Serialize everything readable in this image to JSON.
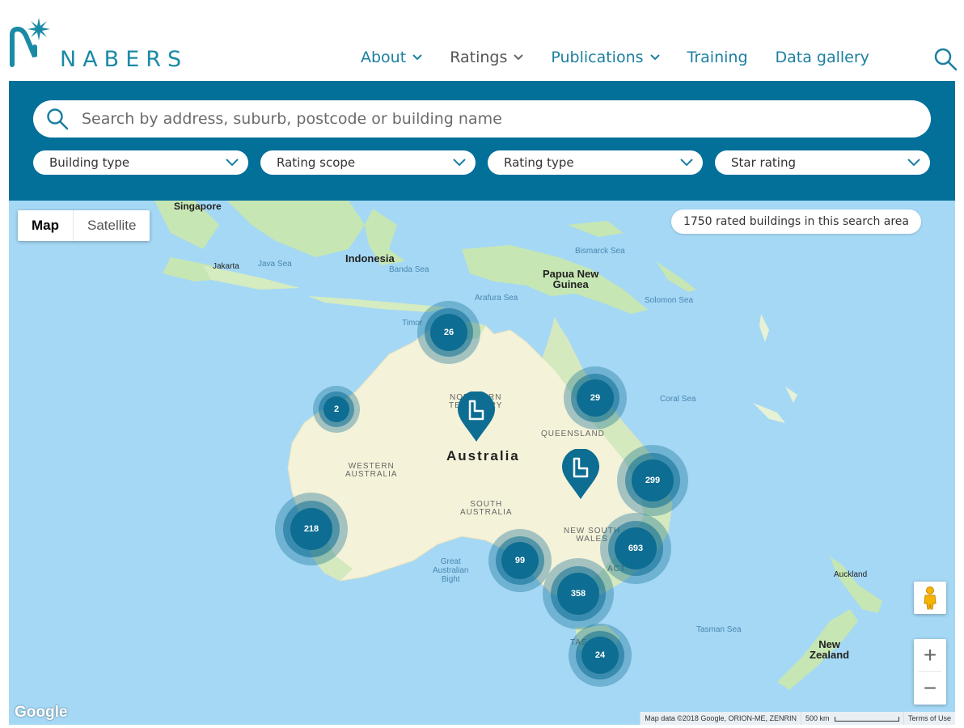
{
  "brand": {
    "name": "NABERS"
  },
  "nav": [
    {
      "label": "About",
      "has_dropdown": true
    },
    {
      "label": "Ratings",
      "has_dropdown": true
    },
    {
      "label": "Publications",
      "has_dropdown": true
    },
    {
      "label": "Training",
      "has_dropdown": false
    },
    {
      "label": "Data gallery",
      "has_dropdown": false
    }
  ],
  "search": {
    "placeholder": "Search by address, suburb, postcode or building name",
    "value": ""
  },
  "filters": [
    {
      "label": "Building type"
    },
    {
      "label": "Rating scope"
    },
    {
      "label": "Rating type"
    },
    {
      "label": "Star rating"
    }
  ],
  "map": {
    "type_toggle": {
      "map_label": "Map",
      "satellite_label": "Satellite",
      "selected": "Map"
    },
    "result_count": "1750 rated buildings in this search area",
    "places": {
      "singapore": "Singapore",
      "jakarta": "Jakarta",
      "java_sea": "Java Sea",
      "indonesia": "Indonesia",
      "banda_sea": "Banda Sea",
      "bismarck_sea": "Bismarck Sea",
      "png_line1": "Papua New",
      "png_line2": "Guinea",
      "arafura_sea": "Arafura Sea",
      "solomon_sea": "Solomon Sea",
      "timor": "Timor",
      "coral_sea": "Coral Sea",
      "northern_territory_1": "NORTHERN",
      "northern_territory_2": "TERRITORY",
      "queensland": "QUEENSLAND",
      "australia": "Australia",
      "western_australia_1": "WESTERN",
      "western_australia_2": "AUSTRALIA",
      "south_australia_1": "SOUTH",
      "south_australia_2": "AUSTRALIA",
      "nsw_1": "NEW SOUTH",
      "nsw_2": "WALES",
      "act": "ACT",
      "great_bight_1": "Great",
      "great_bight_2": "Australian",
      "great_bight_3": "Bight",
      "tasman_sea": "Tasman Sea",
      "auckland": "Auckland",
      "nz_line1": "New",
      "nz_line2": "Zealand",
      "tas": "TAS"
    },
    "clusters": [
      {
        "id": "nt-north",
        "count": "26"
      },
      {
        "id": "wa-north",
        "count": "2"
      },
      {
        "id": "qld-north",
        "count": "29"
      },
      {
        "id": "qld-se",
        "count": "299"
      },
      {
        "id": "wa-perth",
        "count": "218"
      },
      {
        "id": "nsw-sydney",
        "count": "693"
      },
      {
        "id": "sa-adelaide",
        "count": "99"
      },
      {
        "id": "vic-melbourne",
        "count": "358"
      },
      {
        "id": "tas-hobart",
        "count": "24"
      }
    ],
    "pins": [
      {
        "id": "pin-central"
      },
      {
        "id": "pin-qld"
      }
    ],
    "zoom": {
      "in_label": "+",
      "out_label": "−"
    },
    "google_label": "Google",
    "attribution": {
      "data": "Map data ©2018 Google, ORION-ME, ZENRIN",
      "scale": "500 km",
      "terms": "Terms of Use"
    },
    "colors": {
      "water": "#a5d8f5",
      "land": "#f4f2d9",
      "green": "#c6e6b3",
      "cluster": "#0d6d92",
      "band": "#03709a"
    }
  }
}
